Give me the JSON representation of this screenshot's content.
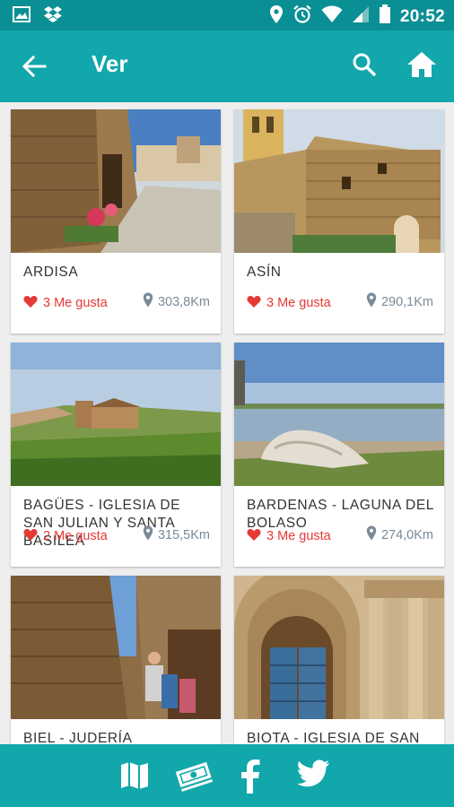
{
  "status_bar": {
    "time": "20:52",
    "icons_left": [
      "image-icon",
      "dropbox-icon"
    ],
    "icons_right": [
      "location-icon",
      "alarm-icon",
      "wifi-icon",
      "signal-icon",
      "battery-icon"
    ]
  },
  "app_bar": {
    "title": "Ver",
    "back_icon": "arrow-back-icon",
    "search_icon": "search-icon",
    "home_icon": "home-icon",
    "color": "#11a7ab"
  },
  "items": [
    {
      "name": "ARDISA",
      "likes": "3 Me gusta",
      "distance": "303,8Km",
      "photo": "stone-street-with-flowers"
    },
    {
      "name": "ASÍN",
      "likes": "3 Me gusta",
      "distance": "290,1Km",
      "photo": "golden-stone-house-tower"
    },
    {
      "name": "BAGÜES - IGLESIA DE SAN JULIAN Y SANTA BASILEA",
      "likes": "2 Me gusta",
      "distance": "315,5Km",
      "photo": "hill-village-church"
    },
    {
      "name": "BARDENAS - LAGUNA DEL BOLASO",
      "likes": "3 Me gusta",
      "distance": "274,0Km",
      "photo": "lagoon-with-rock"
    },
    {
      "name": "BIEL - JUDERÍA",
      "likes": "",
      "distance": "",
      "photo": "narrow-stone-alley"
    },
    {
      "name": "BIOTA - IGLESIA DE SAN",
      "likes": "",
      "distance": "",
      "photo": "romanesque-portal"
    }
  ],
  "bottom_bar": {
    "icons": [
      "map-icon",
      "money-icon",
      "facebook-icon",
      "twitter-icon"
    ]
  },
  "colors": {
    "primary": "#11a7ab",
    "status": "#0a8f94",
    "like": "#e53935",
    "distance": "#7a8a99"
  }
}
